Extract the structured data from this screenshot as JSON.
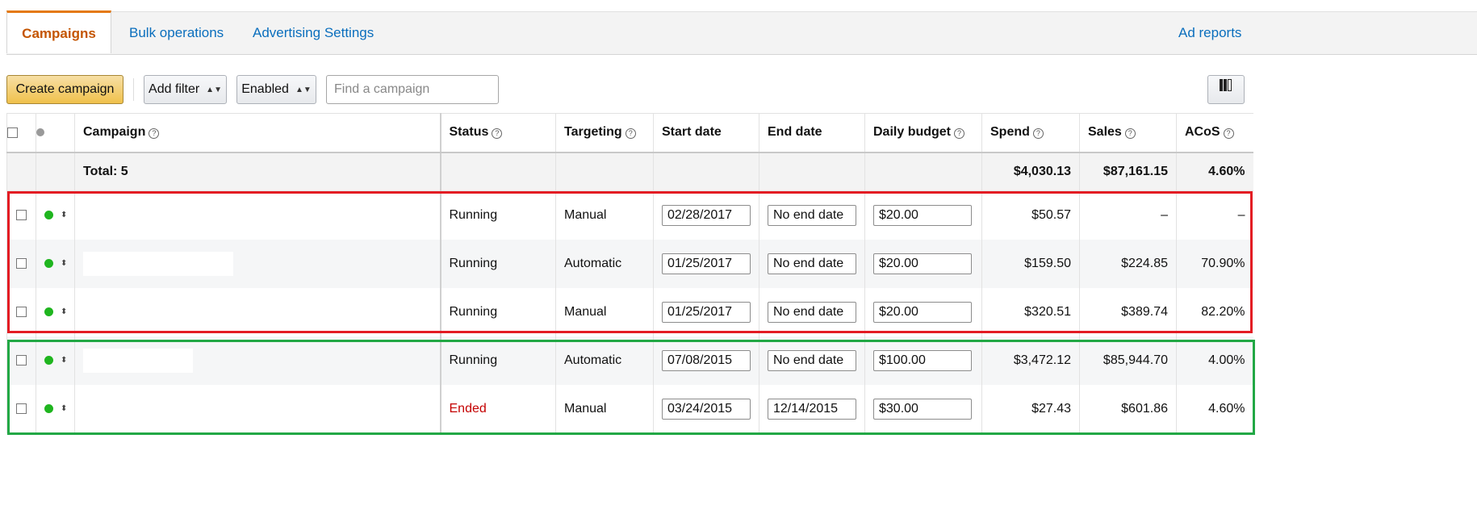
{
  "tabs": {
    "campaigns": "Campaigns",
    "bulk_operations": "Bulk operations",
    "advertising_settings": "Advertising Settings",
    "ad_reports": "Ad reports"
  },
  "toolbar": {
    "create_campaign": "Create campaign",
    "add_filter": "Add filter",
    "enabled_filter": "Enabled",
    "search_placeholder": "Find a campaign",
    "columns_icon": "columns-icon"
  },
  "table": {
    "headers": {
      "campaign": "Campaign",
      "status": "Status",
      "targeting": "Targeting",
      "start_date": "Start date",
      "end_date": "End date",
      "daily_budget": "Daily budget",
      "spend": "Spend",
      "sales": "Sales",
      "acos": "ACoS"
    },
    "total": {
      "label": "Total: 5",
      "spend": "$4,030.13",
      "sales": "$87,161.15",
      "acos": "4.60%"
    },
    "rows": [
      {
        "status": "Running",
        "targeting": "Manual",
        "start_date": "02/28/2017",
        "end_date": "No end date",
        "daily_budget": "$20.00",
        "spend": "$50.57",
        "sales": "–",
        "acos": "–"
      },
      {
        "status": "Running",
        "targeting": "Automatic",
        "start_date": "01/25/2017",
        "end_date": "No end date",
        "daily_budget": "$20.00",
        "spend": "$159.50",
        "sales": "$224.85",
        "acos": "70.90%"
      },
      {
        "status": "Running",
        "targeting": "Manual",
        "start_date": "01/25/2017",
        "end_date": "No end date",
        "daily_budget": "$20.00",
        "spend": "$320.51",
        "sales": "$389.74",
        "acos": "82.20%"
      },
      {
        "status": "Running",
        "targeting": "Automatic",
        "start_date": "07/08/2015",
        "end_date": "No end date",
        "daily_budget": "$100.00",
        "spend": "$3,472.12",
        "sales": "$85,944.70",
        "acos": "4.00%"
      },
      {
        "status": "Ended",
        "targeting": "Manual",
        "start_date": "03/24/2015",
        "end_date": "12/14/2015",
        "daily_budget": "$30.00",
        "spend": "$27.43",
        "sales": "$601.86",
        "acos": "4.60%"
      }
    ]
  },
  "colors": {
    "accent_orange": "#c45500",
    "link_blue": "#0a6ebd",
    "status_running": "#1fb51f",
    "status_ended": "#c40000",
    "highlight_red": "#e31c23",
    "highlight_green": "#22a845"
  }
}
